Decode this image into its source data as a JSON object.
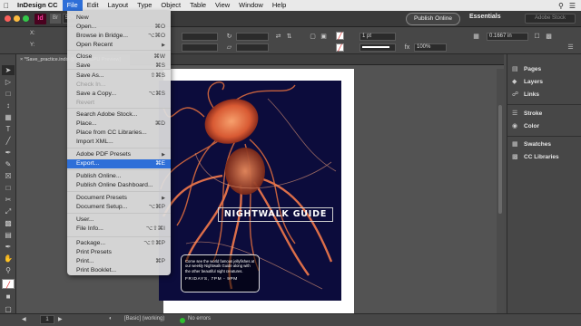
{
  "menubar": {
    "app": "InDesign CC",
    "items": [
      "File",
      "Edit",
      "Layout",
      "Type",
      "Object",
      "Table",
      "View",
      "Window",
      "Help"
    ],
    "active": "File"
  },
  "appbar": {
    "app_badge": "Id",
    "zoom": "50%",
    "publish_button": "Publish Online",
    "workspace": "Essentials",
    "search_placeholder": "Adobe Stock"
  },
  "control": {
    "x_label": "X:",
    "y_label": "Y:",
    "stroke_weight": "1 pt",
    "percent": "100%",
    "offset": "0.1667 in"
  },
  "document_tab": "*Save_practice.indd @ 50% [GPU Preview]",
  "file_menu": {
    "items": [
      {
        "label": "New",
        "shortcut": "",
        "disabled": false,
        "highlight": false
      },
      {
        "label": "Open...",
        "shortcut": "⌘O",
        "disabled": false,
        "highlight": false
      },
      {
        "label": "Browse in Bridge...",
        "shortcut": "⌥⌘O",
        "disabled": false,
        "highlight": false
      },
      {
        "label": "Open Recent",
        "shortcut": "",
        "disabled": false,
        "highlight": false
      },
      {
        "label": "Close",
        "shortcut": "⌘W",
        "disabled": false,
        "highlight": false
      },
      {
        "label": "Save",
        "shortcut": "⌘S",
        "disabled": false,
        "highlight": false
      },
      {
        "label": "Save As...",
        "shortcut": "⇧⌘S",
        "disabled": false,
        "highlight": false
      },
      {
        "label": "Check In...",
        "shortcut": "",
        "disabled": true,
        "highlight": false
      },
      {
        "label": "Save a Copy...",
        "shortcut": "⌥⌘S",
        "disabled": false,
        "highlight": false
      },
      {
        "label": "Revert",
        "shortcut": "",
        "disabled": true,
        "highlight": false
      },
      {
        "label": "Search Adobe Stock...",
        "shortcut": "",
        "disabled": false,
        "highlight": false
      },
      {
        "label": "Place...",
        "shortcut": "⌘D",
        "disabled": false,
        "highlight": false
      },
      {
        "label": "Place from CC Libraries...",
        "shortcut": "",
        "disabled": false,
        "highlight": false
      },
      {
        "label": "Import XML...",
        "shortcut": "",
        "disabled": false,
        "highlight": false
      },
      {
        "label": "Adobe PDF Presets",
        "shortcut": "",
        "disabled": false,
        "highlight": false
      },
      {
        "label": "Export...",
        "shortcut": "⌘E",
        "disabled": false,
        "highlight": true
      },
      {
        "label": "Publish Online...",
        "shortcut": "",
        "disabled": false,
        "highlight": false
      },
      {
        "label": "Publish Online Dashboard...",
        "shortcut": "",
        "disabled": false,
        "highlight": false
      },
      {
        "label": "Document Presets",
        "shortcut": "",
        "disabled": false,
        "highlight": false
      },
      {
        "label": "Document Setup...",
        "shortcut": "⌥⌘P",
        "disabled": false,
        "highlight": false
      },
      {
        "label": "User...",
        "shortcut": "",
        "disabled": false,
        "highlight": false
      },
      {
        "label": "File Info...",
        "shortcut": "⌥⇧⌘I",
        "disabled": false,
        "highlight": false
      },
      {
        "label": "Package...",
        "shortcut": "⌥⇧⌘P",
        "disabled": false,
        "highlight": false
      },
      {
        "label": "Print Presets",
        "shortcut": "",
        "disabled": false,
        "highlight": false
      },
      {
        "label": "Print...",
        "shortcut": "⌘P",
        "disabled": false,
        "highlight": false
      },
      {
        "label": "Print Booklet...",
        "shortcut": "",
        "disabled": false,
        "highlight": false
      }
    ]
  },
  "poster": {
    "headline": "NIGHTWALK GUIDE",
    "copy": "Come see the world famous jellyfishes at our weekly Nightwalk Guide along with the other beautiful night creatures.",
    "date_line": "FRIDAYS, 7PM - 9PM"
  },
  "panels": [
    "Pages",
    "Layers",
    "Links",
    "Stroke",
    "Color",
    "Swatches",
    "CC Libraries"
  ],
  "statusbar": {
    "page": "1",
    "style": "[Basic] (working)",
    "errors": "No errors"
  },
  "colors": {
    "accent": "#2e6fd8",
    "poster_bg": "#0c0c3c",
    "jellyfish": "#e8744a",
    "status_ok": "#2fbf2f"
  }
}
